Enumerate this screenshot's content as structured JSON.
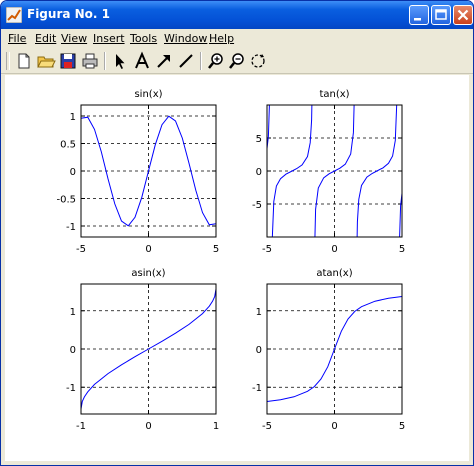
{
  "window": {
    "title": "Figura No. 1"
  },
  "menu": [
    "File",
    "Edit",
    "View",
    "Insert",
    "Tools",
    "Window",
    "Help"
  ],
  "toolbar_icons": [
    "new-file-icon",
    "open-folder-icon",
    "save-icon",
    "print-icon",
    "arrow-icon",
    "text-icon",
    "line-arrow-icon",
    "line-icon",
    "zoom-in-icon",
    "zoom-out-icon",
    "rotate-icon"
  ],
  "colors": {
    "line": "#0000ff",
    "titlebar": "#0451d6"
  },
  "chart_data": [
    {
      "type": "line",
      "title": "sin(x)",
      "xlim": [
        -5,
        5
      ],
      "ylim": [
        -1.2,
        1.2
      ],
      "xticks": [
        -5,
        0,
        5
      ],
      "xtick_labels": [
        "-5",
        "0",
        "5"
      ],
      "yticks": [
        1,
        0.5,
        0,
        -0.5,
        -1
      ],
      "ytick_labels": [
        "1",
        "0.5",
        "0",
        "-0.5",
        "-1"
      ],
      "grid": true,
      "x": [
        -5,
        -4.5,
        -4,
        -3.5,
        -3,
        -2.5,
        -2,
        -1.5,
        -1,
        -0.5,
        0,
        0.5,
        1,
        1.5,
        2,
        2.5,
        3,
        3.5,
        4,
        4.5,
        5
      ],
      "y": [
        0.959,
        0.978,
        0.757,
        0.351,
        -0.141,
        -0.598,
        -0.909,
        -0.997,
        -0.841,
        -0.479,
        0,
        0.479,
        0.841,
        0.997,
        0.909,
        0.598,
        0.141,
        -0.351,
        -0.757,
        -0.978,
        -0.959
      ]
    },
    {
      "type": "line",
      "title": "tan(x)",
      "xlim": [
        -5,
        5
      ],
      "ylim": [
        -10,
        10
      ],
      "xticks": [
        -5,
        0,
        5
      ],
      "xtick_labels": [
        "-5",
        "0",
        "5"
      ],
      "yticks": [
        5,
        0,
        -5
      ],
      "ytick_labels": [
        "5",
        "0",
        "-5"
      ],
      "grid": true,
      "segments": [
        {
          "x": [
            -5,
            -4.9,
            -4.8,
            -4.75
          ],
          "y": [
            3.38,
            5.27,
            11.38,
            29.9
          ]
        },
        {
          "x": [
            -4.65,
            -4.5,
            -4.3,
            -4.0,
            -3.6,
            -3.14,
            -2.8,
            -2.4,
            -2.0,
            -1.8,
            -1.7,
            -1.65
          ],
          "y": [
            -12.39,
            -4.64,
            -2.28,
            -1.16,
            -0.49,
            0,
            0.36,
            0.92,
            2.19,
            4.29,
            7.7,
            12.59
          ]
        },
        {
          "x": [
            -1.5,
            -1.4,
            -1.2,
            -0.8,
            -0.4,
            0,
            0.4,
            0.8,
            1.2,
            1.4,
            1.5
          ],
          "y": [
            -14.1,
            -5.8,
            -2.57,
            -1.03,
            -0.42,
            0,
            0.42,
            1.03,
            2.57,
            5.8,
            14.1
          ]
        },
        {
          "x": [
            1.65,
            1.7,
            1.8,
            2.0,
            2.4,
            2.8,
            3.14,
            3.6,
            4.0,
            4.3,
            4.5,
            4.65
          ],
          "y": [
            -12.59,
            -7.7,
            -4.29,
            -2.19,
            -0.92,
            -0.36,
            0,
            0.49,
            1.16,
            2.28,
            4.64,
            12.39
          ]
        },
        {
          "x": [
            4.75,
            4.8,
            4.9,
            5
          ],
          "y": [
            -29.9,
            -11.38,
            -5.27,
            -3.38
          ]
        }
      ]
    },
    {
      "type": "line",
      "title": "asin(x)",
      "xlim": [
        -1,
        1
      ],
      "ylim": [
        -1.7,
        1.7
      ],
      "xticks": [
        -1,
        0,
        1
      ],
      "xtick_labels": [
        "-1",
        "0",
        "1"
      ],
      "yticks": [
        1,
        0,
        -1
      ],
      "ytick_labels": [
        "1",
        "0",
        "-1"
      ],
      "grid": true,
      "x": [
        -1,
        -0.98,
        -0.95,
        -0.9,
        -0.8,
        -0.6,
        -0.4,
        -0.2,
        0,
        0.2,
        0.4,
        0.6,
        0.8,
        0.9,
        0.95,
        0.98,
        1
      ],
      "y": [
        -1.571,
        -1.37,
        -1.253,
        -1.12,
        -0.927,
        -0.644,
        -0.412,
        -0.201,
        0,
        0.201,
        0.412,
        0.644,
        0.927,
        1.12,
        1.253,
        1.37,
        1.571
      ]
    },
    {
      "type": "line",
      "title": "atan(x)",
      "xlim": [
        -5,
        5
      ],
      "ylim": [
        -1.7,
        1.7
      ],
      "xticks": [
        -5,
        0,
        5
      ],
      "xtick_labels": [
        "-5",
        "0",
        "5"
      ],
      "yticks": [
        1,
        0,
        -1
      ],
      "ytick_labels": [
        "1",
        "0",
        "-1"
      ],
      "grid": true,
      "x": [
        -5,
        -4,
        -3,
        -2,
        -1.5,
        -1,
        -0.5,
        0,
        0.5,
        1,
        1.5,
        2,
        3,
        4,
        5
      ],
      "y": [
        -1.373,
        -1.326,
        -1.249,
        -1.107,
        -0.983,
        -0.785,
        -0.464,
        0,
        0.464,
        0.785,
        0.983,
        1.107,
        1.249,
        1.326,
        1.373
      ]
    }
  ]
}
